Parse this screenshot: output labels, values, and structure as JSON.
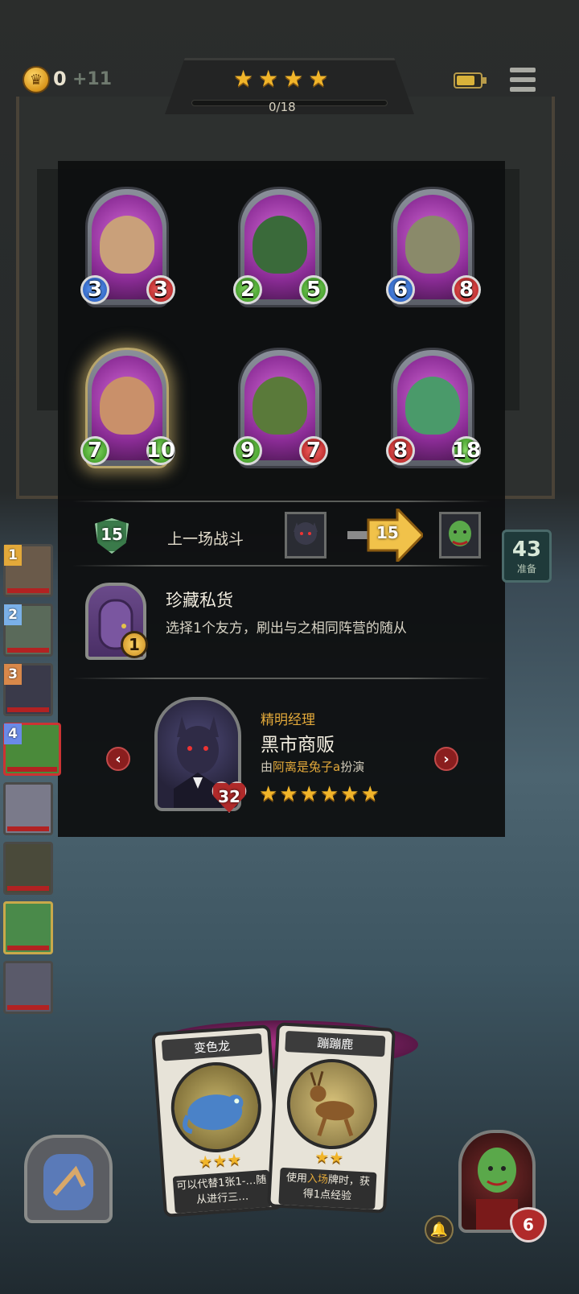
{
  "hud": {
    "coins": "0",
    "coin_income": "+11",
    "tier_stars": 4,
    "progress_text": "0/18",
    "progress_value": 0,
    "progress_max": 18,
    "battery_level": 0.8
  },
  "minions": [
    {
      "attack": "3",
      "health": "3",
      "golden": false,
      "attack_color": "blue",
      "health_color": "red"
    },
    {
      "attack": "2",
      "health": "5",
      "golden": false,
      "attack_color": "green",
      "health_color": "green"
    },
    {
      "attack": "6",
      "health": "8",
      "golden": false,
      "attack_color": "blue",
      "health_color": "red"
    },
    {
      "attack": "7",
      "health": "10",
      "golden": true,
      "attack_color": "green",
      "health_color": "green"
    },
    {
      "attack": "9",
      "health": "7",
      "golden": false,
      "attack_color": "green",
      "health_color": "red"
    },
    {
      "attack": "8",
      "health": "18",
      "golden": false,
      "attack_color": "red",
      "health_color": "green"
    }
  ],
  "last_battle": {
    "tier": "15",
    "label": "上一场战斗",
    "damage": "15"
  },
  "treasure": {
    "cost": "1",
    "title": "珍藏私货",
    "description": "选择1个友方，刷出与之相同阵营的随从"
  },
  "hero": {
    "subtitle": "精明经理",
    "name": "黑市商贩",
    "by_prefix": "由",
    "player": "阿离是兔子a",
    "by_suffix": "扮演",
    "health": "32",
    "stars": 6
  },
  "sidebar": [
    {
      "rank": "1",
      "rank_color": "#e3a93a"
    },
    {
      "rank": "2",
      "rank_color": "#7ab0e8"
    },
    {
      "rank": "3",
      "rank_color": "#d8884a"
    },
    {
      "rank": "4",
      "rank_color": "#6a8ae8"
    },
    {
      "rank": "",
      "rank_color": ""
    },
    {
      "rank": "",
      "rank_color": ""
    },
    {
      "rank": "",
      "rank_color": ""
    },
    {
      "rank": "",
      "rank_color": ""
    }
  ],
  "ready": {
    "count": "43",
    "label": "准备"
  },
  "hand": [
    {
      "title": "变色龙",
      "stars": 3,
      "desc": "可以代替1张1-…随从进行三…"
    },
    {
      "title": "蹦蹦鹿",
      "stars": 2,
      "desc_pre": "使用",
      "desc_hl": "入场",
      "desc_post": "牌时，获得1点经验"
    }
  ],
  "player": {
    "health": "6"
  },
  "colors": {
    "gold": "#f1b52a",
    "accent_orange": "#e3a93a",
    "health_red": "#b02a2a",
    "panel_bg": "#0e0f10"
  }
}
